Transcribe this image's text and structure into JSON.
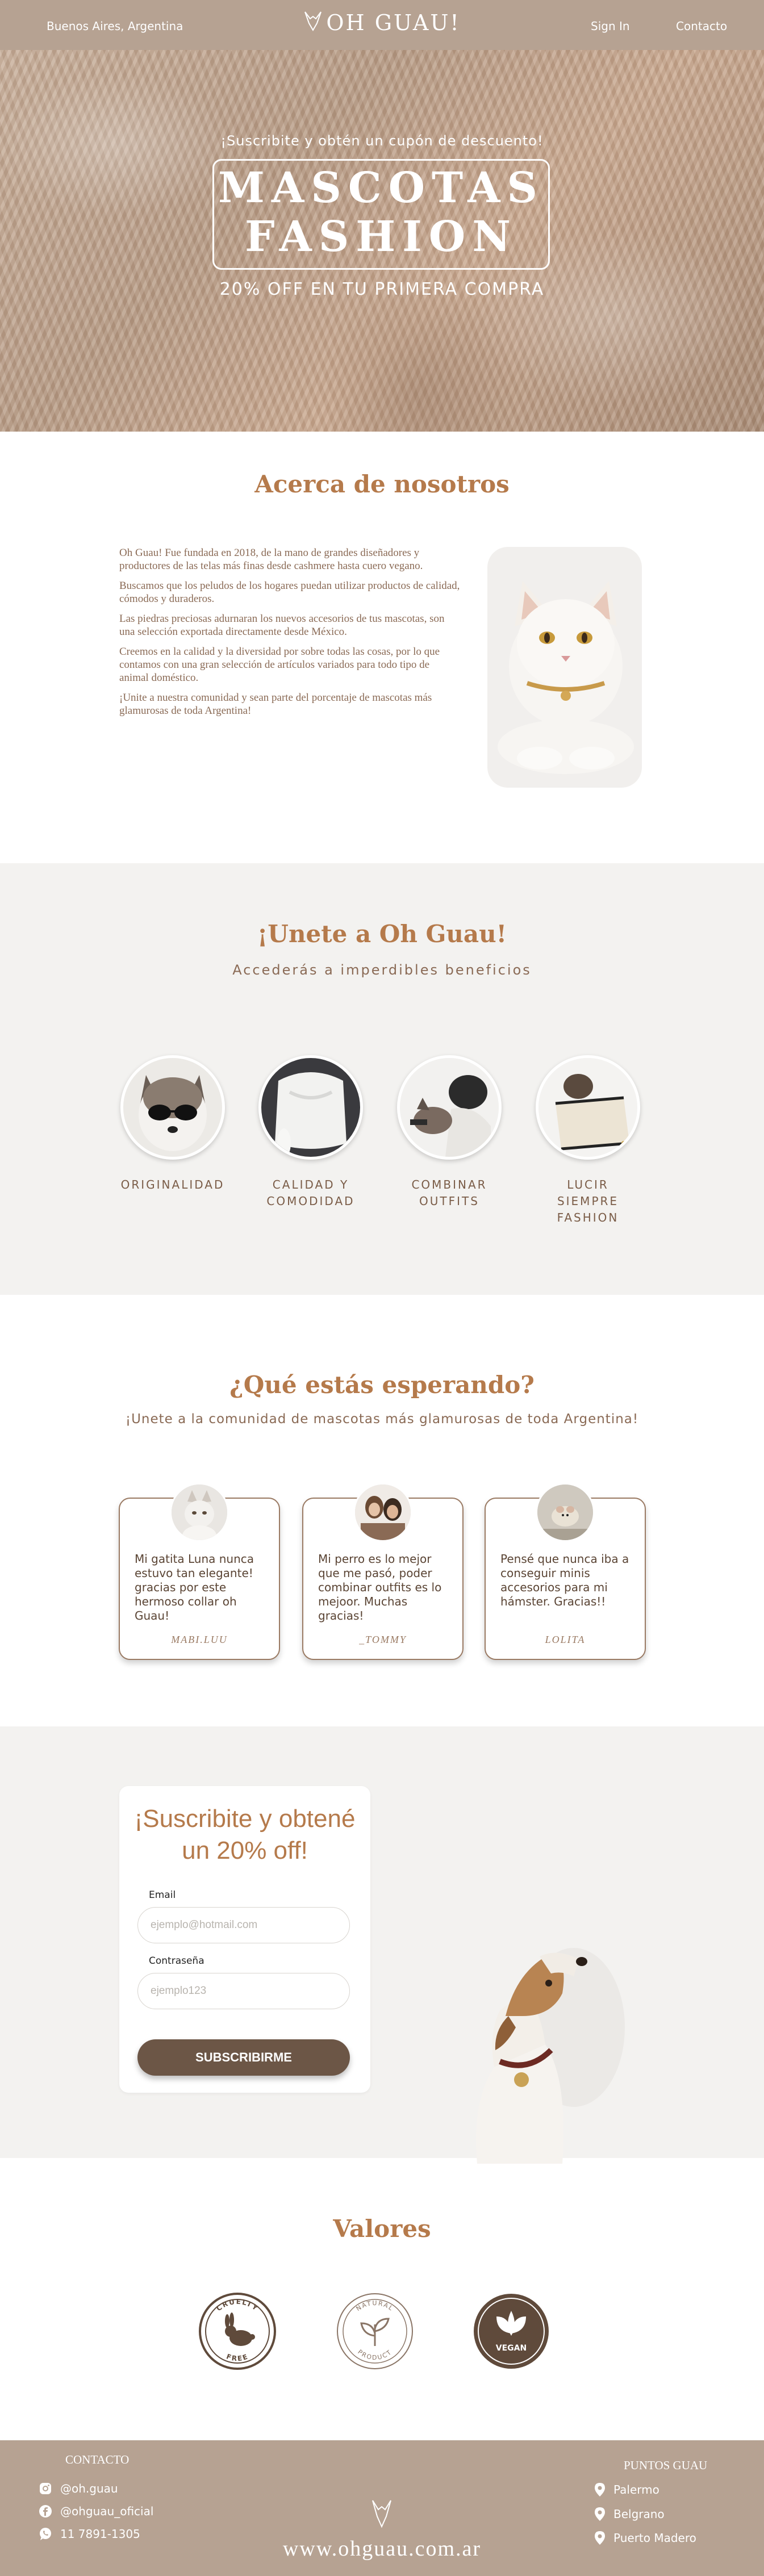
{
  "header": {
    "location": "Buenos Aires, Argentina",
    "brand": "OH GUAU!",
    "signin": "Sign In",
    "contact": "Contacto"
  },
  "hero": {
    "tagline": "¡Suscribite y obtén un cupón de descuento!",
    "title_line1": "MASCOTAS",
    "title_line2": "FASHION",
    "offer": "20% OFF EN TU PRIMERA COMPRA"
  },
  "about": {
    "title": "Acerca de nosotros",
    "paragraphs": [
      "Oh Guau! Fue fundada en 2018, de la mano de grandes diseñadores y productores de las telas más finas desde cashmere hasta cuero vegano.",
      "Buscamos que los peludos de los hogares puedan utilizar productos de calidad, cómodos y duraderos.",
      "Las piedras preciosas adurnaran los nuevos accesorios de tus mascotas, son una selección exportada directamente desde México.",
      "Creemos en la calidad y la diversidad por sobre todas las cosas, por lo que contamos con una gran selección de artículos variados para todo tipo de animal doméstico.",
      "¡Unite a nuestra comunidad y sean parte del  porcentaje de mascotas más glamurosas de toda Argentina!"
    ]
  },
  "join": {
    "title": "¡Unete a Oh Guau!",
    "subtitle": "Accederás a imperdibles beneficios",
    "benefits": [
      {
        "line1": "ORIGINALIDAD",
        "line2": ""
      },
      {
        "line1": "CALIDAD Y",
        "line2": "COMODIDAD"
      },
      {
        "line1": "COMBINAR",
        "line2": "OUTFITS"
      },
      {
        "line1": "LUCIR SIEMPRE",
        "line2": "FASHION"
      }
    ]
  },
  "testimonials": {
    "title": "¿Qué estás esperando?",
    "subtitle": "¡Unete a la comunidad de mascotas más glamurosas de toda Argentina!",
    "items": [
      {
        "quote": "Mi gatita Luna nunca estuvo tan elegante! gracias por este hermoso collar oh Guau!",
        "author": "MABI.LUU"
      },
      {
        "quote": "Mi perro es lo mejor que me pasó, poder combinar outfits es lo mejoor. Muchas gracias!",
        "author": "_TOMMY"
      },
      {
        "quote": "Pensé que nunca iba a conseguir minis accesorios para mi hámster. Gracias!!",
        "author": "LOLITA"
      }
    ]
  },
  "subscribe": {
    "title_line1": "¡Suscribite y obtené",
    "title_line2": "un 20% off!",
    "email_label": "Email",
    "email_placeholder": "ejemplo@hotmail.com",
    "password_label": "Contraseña",
    "password_placeholder": "ejemplo123",
    "button": "SUBSCRIBIRME"
  },
  "values": {
    "title": "Valores",
    "badges": [
      {
        "icon": "rabbit-icon",
        "top": "CRUELTY",
        "bottom": "FREE"
      },
      {
        "icon": "leaf-icon",
        "top": "NATURAL",
        "bottom": "PRODUCT"
      },
      {
        "icon": "vegan-leaf-icon",
        "center": "VEGAN"
      }
    ]
  },
  "footer": {
    "contact_heading": "CONTACTO",
    "instagram": "@oh.guau",
    "facebook": "@ohguau_oficial",
    "whatsapp": "11 7891-1305",
    "website": "www.ohguau.com.ar",
    "stores_heading": "PUNTOS GUAU",
    "stores": [
      "Palermo",
      "Belgrano",
      "Puerto Madero"
    ]
  },
  "colors": {
    "header_bg": "#b6a292",
    "accent": "#b57a4b",
    "button": "#6c5646",
    "section_bg": "#f3f2f0"
  }
}
